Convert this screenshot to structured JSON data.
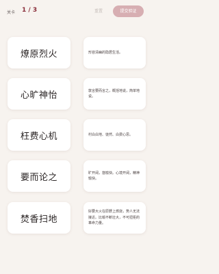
{
  "header": {
    "level_label": "关卡",
    "level_value": "1 / 3",
    "reset_label": "重置",
    "submit_label": "提交验证"
  },
  "terms": [
    {
      "label": "燎原烈火"
    },
    {
      "label": "心旷神怡"
    },
    {
      "label": "枉费心机"
    },
    {
      "label": "要而论之"
    },
    {
      "label": "焚香扫地"
    }
  ],
  "definitions": [
    {
      "text": "形容清幽的隐居生活。"
    },
    {
      "text": "敦言要而言之，概括地说，简单地说。"
    },
    {
      "text": "村白白地、徒然、白费心思。"
    },
    {
      "text": "旷开阔，悠愉快。心境开阔，精神愉快。"
    },
    {
      "text": "好要大火在原野上燃烧，势人无法接近。比喻不断壮大，不可扭拒的革命力量。"
    }
  ],
  "colors": {
    "background": "#f7f3ef",
    "accent": "#8a2d3a",
    "submit_button": "#d7aeb2"
  }
}
